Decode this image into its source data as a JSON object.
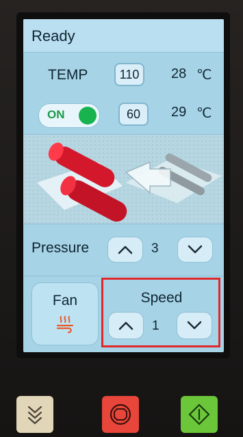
{
  "status": {
    "title": "Ready"
  },
  "temp_row": {
    "label": "TEMP",
    "setpoint": "110",
    "actual": "28",
    "unit": "℃"
  },
  "power_row": {
    "toggle_label": "ON",
    "setpoint": "60",
    "actual": "29",
    "unit": "℃"
  },
  "pressure": {
    "label": "Pressure",
    "value": "3"
  },
  "fan": {
    "label": "Fan"
  },
  "speed": {
    "label": "Speed",
    "value": "1"
  },
  "colors": {
    "screen_bg": "#a6d3e6",
    "toggle_on": "#18b34f",
    "highlight": "#e0262a",
    "fan_icon": "#e85a2a",
    "hw_left": "#e2d6b8",
    "hw_stop": "#e8463a",
    "hw_start": "#6cc63a"
  },
  "icons": [
    "chevron-up-icon",
    "chevron-down-icon",
    "fan-heat-icon",
    "double-chevron-down-icon",
    "stop-icon",
    "start-icon"
  ]
}
